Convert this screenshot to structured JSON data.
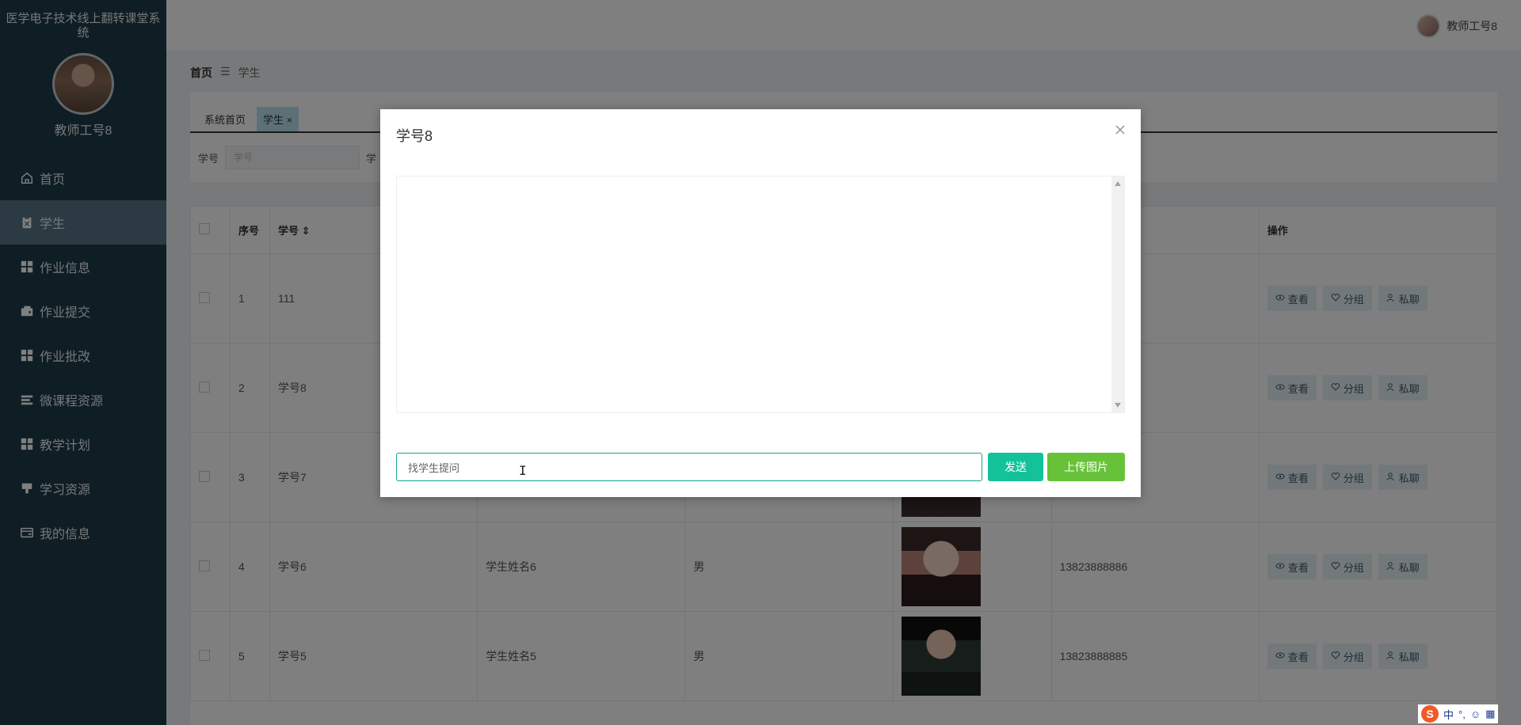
{
  "app": {
    "title": "医学电子技术线上翻转课堂系统",
    "teacher_name": "教师工号8"
  },
  "sidebar": {
    "items": [
      {
        "label": "首页",
        "icon": "home-icon",
        "active": false
      },
      {
        "label": "学生",
        "icon": "clipboard-icon",
        "active": true
      },
      {
        "label": "作业信息",
        "icon": "grid-icon",
        "active": false
      },
      {
        "label": "作业提交",
        "icon": "wallet-icon",
        "active": false
      },
      {
        "label": "作业批改",
        "icon": "grid-icon",
        "active": false
      },
      {
        "label": "微课程资源",
        "icon": "list-icon",
        "active": false
      },
      {
        "label": "教学计划",
        "icon": "grid-icon",
        "active": false
      },
      {
        "label": "学习资源",
        "icon": "stamp-icon",
        "active": false
      },
      {
        "label": "我的信息",
        "icon": "card-icon",
        "active": false
      }
    ]
  },
  "header": {
    "user_name": "教师工号8"
  },
  "breadcrumb": {
    "home": "首页",
    "separator": "☰",
    "current": "学生"
  },
  "tabs": [
    {
      "label": "系统首页"
    },
    {
      "label": "学生",
      "closable": true
    }
  ],
  "search": {
    "label1": "学号",
    "placeholder1": "学号",
    "label2": "学"
  },
  "table": {
    "headers": {
      "index": "序号",
      "student_id": "学号",
      "ops": "操作"
    },
    "rows": [
      {
        "index": "1",
        "student_id": "111",
        "name": "",
        "gender": "",
        "phone": "",
        "photo": "ph-0"
      },
      {
        "index": "2",
        "student_id": "学号8",
        "name": "",
        "gender": "",
        "phone": "",
        "photo": "ph-0"
      },
      {
        "index": "3",
        "student_id": "学号7",
        "name": "",
        "gender": "",
        "phone": "",
        "photo": "ph-0"
      },
      {
        "index": "4",
        "student_id": "学号6",
        "name": "学生姓名6",
        "gender": "男",
        "phone": "13823888886",
        "photo": "ph-1"
      },
      {
        "index": "5",
        "student_id": "学号5",
        "name": "学生姓名5",
        "gender": "男",
        "phone": "13823888885",
        "photo": "ph-2"
      }
    ],
    "op_labels": {
      "view": "查看",
      "group": "分组",
      "chat": "私聊"
    }
  },
  "dialog": {
    "title": "学号8",
    "input_value": "找学生提问",
    "send_label": "发送",
    "upload_label": "上传图片"
  },
  "ime": {
    "logo": "S",
    "mode": "中",
    "punct": "°,"
  }
}
